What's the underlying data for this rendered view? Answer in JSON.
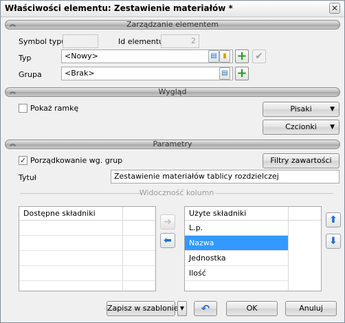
{
  "window": {
    "title": "Właściwości elementu: Zestawienie materiałów *",
    "close_glyph": "✕"
  },
  "sections": {
    "zarzadzanie": "Zarządzanie elementem",
    "wyglad": "Wygląd",
    "parametry": "Parametry",
    "collapse_glyph": "︽"
  },
  "management": {
    "symbol_label": "Symbol typu",
    "symbol_value": "",
    "id_label": "Id elementu",
    "id_value": "2",
    "typ_label": "Typ",
    "typ_value": "<Nowy>",
    "grupa_label": "Grupa",
    "grupa_value": "<Brak>"
  },
  "appearance": {
    "frame_label": "Pokaż ramkę",
    "frame_checked": false,
    "pens_button": "Pisaki",
    "fonts_button": "Czcionki"
  },
  "parameters": {
    "group_sort_label": "Porządkowanie wg. grup",
    "group_sort_checked": true,
    "filters_button": "Filtry zawartości",
    "title_label": "Tytuł",
    "title_value": "Zestawienie materiałów tablicy rozdzielczej",
    "visibility_group": "Widoczność kolumn"
  },
  "available_list": {
    "header": "Dostępne składniki",
    "items": []
  },
  "used_list": {
    "header": "Użyte składniki",
    "items": [
      "L.p.",
      "Nazwa",
      "Jednostka",
      "Ilość"
    ],
    "selected_index": 1
  },
  "footer": {
    "save_template": "Zapisz w szablonie",
    "ok": "OK",
    "cancel": "Anuluj"
  },
  "icons": {
    "plus": "+",
    "check": "✔",
    "arrow_right": "➜",
    "arrow_left": "⬅",
    "arrow_up": "⬆",
    "arrow_down": "⬇",
    "undo": "↶",
    "dropdown": "▼",
    "checkmark": "✓"
  },
  "colors": {
    "selection": "#3399ff",
    "plus_green": "#1e9c1e",
    "accent_blue": "#1f6fd1"
  }
}
